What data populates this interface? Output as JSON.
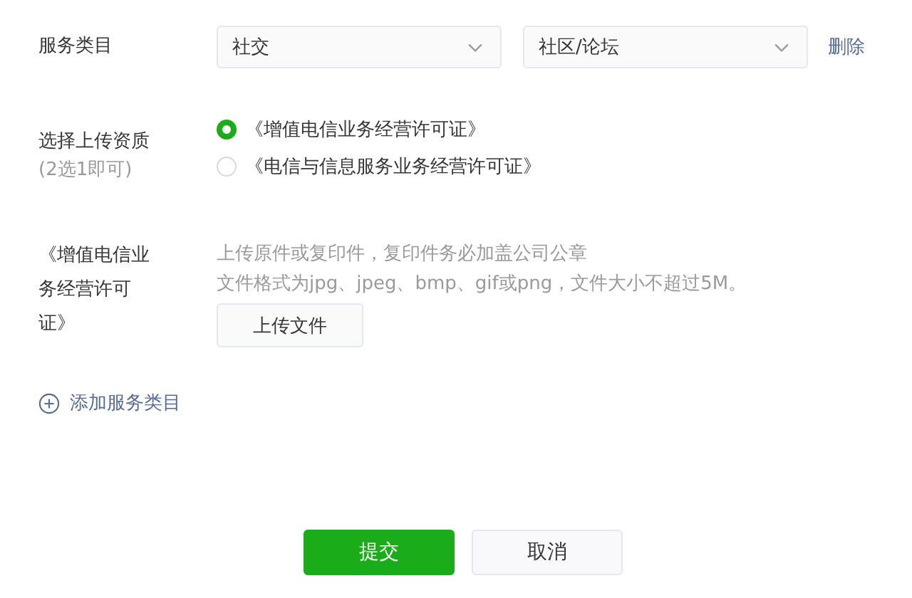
{
  "service_category": {
    "label": "服务类目",
    "selects": [
      {
        "value": "社交"
      },
      {
        "value": "社区/论坛"
      }
    ],
    "delete_link": "删除"
  },
  "qualification": {
    "label": "选择上传资质",
    "hint": "(2选1即可)",
    "options": [
      {
        "label": "《增值电信业务经营许可证》",
        "selected": true
      },
      {
        "label": "《电信与信息服务业务经营许可证》",
        "selected": false
      }
    ]
  },
  "upload": {
    "label": "《增值电信业务经营许可证》",
    "notes": [
      "上传原件或复印件，复印件务必加盖公司公章",
      "文件格式为jpg、jpeg、bmp、gif或png，文件大小不超过5M。"
    ],
    "button": "上传文件"
  },
  "add_link": "添加服务类目",
  "buttons": [
    {
      "label": "提交",
      "kind": "primary"
    },
    {
      "label": "取消",
      "kind": "secondary"
    }
  ]
}
